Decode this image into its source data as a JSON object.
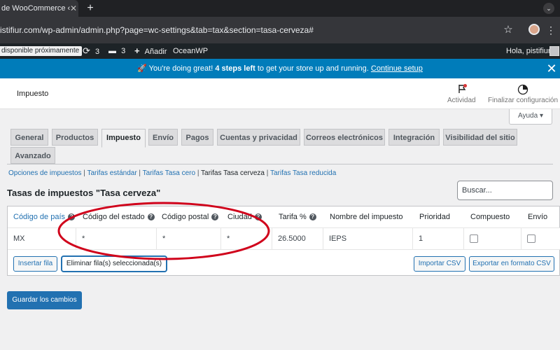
{
  "browser": {
    "tab_title": "de WooCommerce ‹ ",
    "url": "istifiur.com/wp-admin/admin.php?page=wc-settings&tab=tax&section=tasa-cerveza#"
  },
  "adminbar": {
    "update_pill": "disponible próximamente",
    "updates_count": "3",
    "comments_count": "3",
    "new_label": "Añadir",
    "site_name": "OceanWP",
    "greeting": "Hola, pistifiur"
  },
  "notice": {
    "emoji": "🚀",
    "text_pre": " You're doing great! ",
    "text_bold": "4 steps left",
    "text_post": " to get your store up and running. ",
    "link": "Continue setup"
  },
  "wc_header": {
    "title": "Impuesto",
    "activity_label": "Actividad",
    "finish_label": "Finalizar configuración",
    "help_label": "Ayuda ▾"
  },
  "tabs": [
    {
      "label": "General",
      "active": false
    },
    {
      "label": "Productos",
      "active": false
    },
    {
      "label": "Impuesto",
      "active": true
    },
    {
      "label": "Envío",
      "active": false
    },
    {
      "label": "Pagos",
      "active": false
    },
    {
      "label": "Cuentas y privacidad",
      "active": false
    },
    {
      "label": "Correos electrónicos",
      "active": false
    },
    {
      "label": "Integración",
      "active": false
    },
    {
      "label": "Visibilidad del sitio",
      "active": false
    },
    {
      "label": "Avanzado",
      "active": false
    }
  ],
  "subsub": {
    "items": [
      "Opciones de impuestos",
      "Tarifas estándar",
      "Tarifas Tasa cero",
      "Tarifas Tasa cerveza",
      "Tarifas Tasa reducida"
    ],
    "current": "Tarifas Tasa cerveza"
  },
  "section_title": "Tasas de impuestos \"Tasa cerveza\"",
  "search": {
    "placeholder": "Buscar..."
  },
  "table": {
    "headers": [
      "Código de país",
      "Código del estado",
      "Código postal",
      "Ciudad",
      "Tarifa %",
      "Nombre del impuesto",
      "Prioridad",
      "Compuesto",
      "Envío"
    ],
    "row": {
      "country": "MX",
      "state": "*",
      "postcode": "*",
      "city": "*",
      "rate": "26.5000",
      "name": "IEPS",
      "priority": "1",
      "compound": false,
      "shipping": false
    },
    "buttons": {
      "insert": "Insertar fila",
      "remove": "Eliminar fila(s) seleccionada(s)",
      "import": "Importar CSV",
      "export": "Exportar en formato CSV"
    }
  },
  "save_label": "Guardar los cambios",
  "colors": {
    "wp_blue": "#2271b1",
    "notice_blue": "#007cba",
    "annotation_red": "#d0021b"
  }
}
